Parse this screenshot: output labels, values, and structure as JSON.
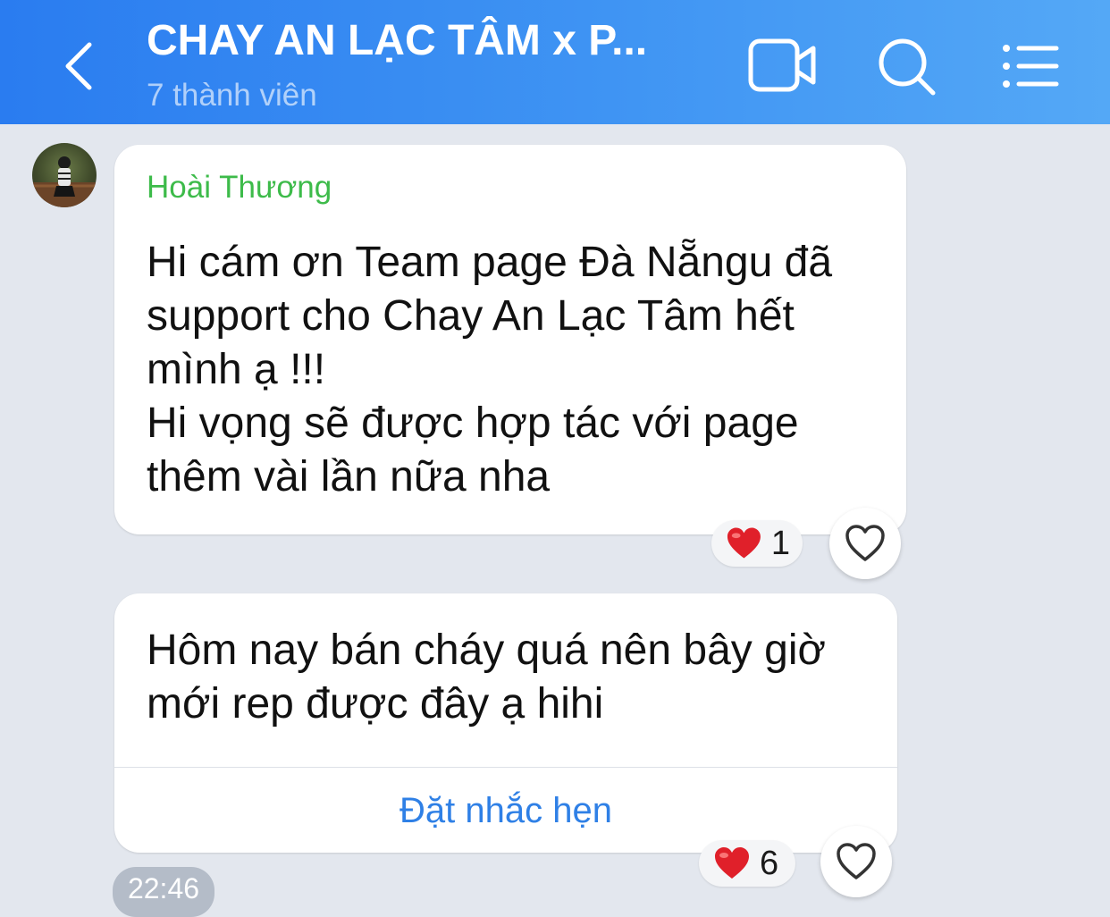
{
  "header": {
    "title": "CHAY AN LẠC TÂM x P...",
    "subtitle": "7 thành viên",
    "icons": {
      "back": "chevron-left-icon",
      "video": "video-camera-icon",
      "search": "search-icon",
      "menu": "list-menu-icon"
    },
    "gradient": [
      "#2a7cf0",
      "#54a8f6"
    ]
  },
  "messages": [
    {
      "sender": "Hoài Thương",
      "sender_color": "#3dbb4a",
      "lines": [
        "Hi cám ơn Team page Đà Nẵngu đã",
        "support cho Chay An Lạc Tâm hết",
        "mình ạ !!!",
        "Hi vọng sẽ được hợp tác với page",
        "thêm vài lần nữa nha"
      ],
      "reaction": {
        "icon": "heart-icon",
        "count": "1"
      }
    },
    {
      "lines": [
        "Hôm nay bán cháy quá nên bây giờ",
        "mới rep được đây ạ hihi"
      ],
      "action_label": "Đặt nhắc hẹn",
      "reaction": {
        "icon": "heart-icon",
        "count": "6"
      },
      "time": "22:46"
    }
  ],
  "colors": {
    "background": "#e3e7ee",
    "link": "#2f80e6",
    "heart": "#e0202a"
  }
}
